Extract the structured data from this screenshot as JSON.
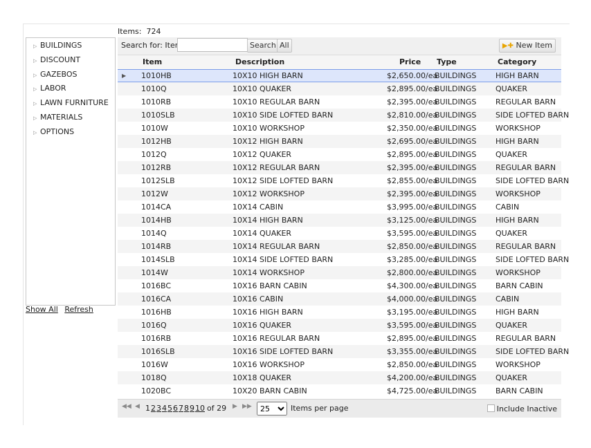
{
  "items_label": "Items:",
  "items_count": "724",
  "sidebar": {
    "categories": [
      "BUILDINGS",
      "DISCOUNT",
      "GAZEBOS",
      "LABOR",
      "LAWN FURNITURE",
      "MATERIALS",
      "OPTIONS"
    ],
    "show_all": "Show All",
    "refresh": "Refresh"
  },
  "search": {
    "label": "Search for: Item:",
    "value": "",
    "button": "Search",
    "all_button": "All",
    "new_item": "New Item"
  },
  "columns": {
    "item": "Item",
    "description": "Description",
    "price": "Price",
    "type": "Type",
    "category": "Category"
  },
  "rows": [
    [
      "1010HB",
      "10X10 HIGH BARN",
      "$2,650.00/ea",
      "BUILDINGS",
      "HIGH BARN"
    ],
    [
      "1010Q",
      "10X10 QUAKER",
      "$2,895.00/ea",
      "BUILDINGS",
      "QUAKER"
    ],
    [
      "1010RB",
      "10X10 REGULAR BARN",
      "$2,395.00/ea",
      "BUILDINGS",
      "REGULAR BARN"
    ],
    [
      "1010SLB",
      "10X10 SIDE LOFTED BARN",
      "$2,810.00/ea",
      "BUILDINGS",
      "SIDE LOFTED BARN"
    ],
    [
      "1010W",
      "10X10 WORKSHOP",
      "$2,350.00/ea",
      "BUILDINGS",
      "WORKSHOP"
    ],
    [
      "1012HB",
      "10X12 HIGH BARN",
      "$2,695.00/ea",
      "BUILDINGS",
      "HIGH BARN"
    ],
    [
      "1012Q",
      "10X12 QUAKER",
      "$2,895.00/ea",
      "BUILDINGS",
      "QUAKER"
    ],
    [
      "1012RB",
      "10X12 REGULAR BARN",
      "$2,395.00/ea",
      "BUILDINGS",
      "REGULAR BARN"
    ],
    [
      "1012SLB",
      "10X12 SIDE LOFTED BARN",
      "$2,855.00/ea",
      "BUILDINGS",
      "SIDE LOFTED BARN"
    ],
    [
      "1012W",
      "10X12 WORKSHOP",
      "$2,395.00/ea",
      "BUILDINGS",
      "WORKSHOP"
    ],
    [
      "1014CA",
      "10X14 CABIN",
      "$3,995.00/ea",
      "BUILDINGS",
      "CABIN"
    ],
    [
      "1014HB",
      "10X14 HIGH BARN",
      "$3,125.00/ea",
      "BUILDINGS",
      "HIGH BARN"
    ],
    [
      "1014Q",
      "10X14 QUAKER",
      "$3,595.00/ea",
      "BUILDINGS",
      "QUAKER"
    ],
    [
      "1014RB",
      "10X14 REGULAR BARN",
      "$2,850.00/ea",
      "BUILDINGS",
      "REGULAR BARN"
    ],
    [
      "1014SLB",
      "10X14 SIDE LOFTED BARN",
      "$3,285.00/ea",
      "BUILDINGS",
      "SIDE LOFTED BARN"
    ],
    [
      "1014W",
      "10X14 WORKSHOP",
      "$2,800.00/ea",
      "BUILDINGS",
      "WORKSHOP"
    ],
    [
      "1016BC",
      "10X16 BARN CABIN",
      "$4,300.00/ea",
      "BUILDINGS",
      "BARN CABIN"
    ],
    [
      "1016CA",
      "10X16 CABIN",
      "$4,000.00/ea",
      "BUILDINGS",
      "CABIN"
    ],
    [
      "1016HB",
      "10X16 HIGH BARN",
      "$3,195.00/ea",
      "BUILDINGS",
      "HIGH BARN"
    ],
    [
      "1016Q",
      "10X16 QUAKER",
      "$3,595.00/ea",
      "BUILDINGS",
      "QUAKER"
    ],
    [
      "1016RB",
      "10X16 REGULAR BARN",
      "$2,895.00/ea",
      "BUILDINGS",
      "REGULAR BARN"
    ],
    [
      "1016SLB",
      "10X16 SIDE LOFTED BARN",
      "$3,355.00/ea",
      "BUILDINGS",
      "SIDE LOFTED BARN"
    ],
    [
      "1016W",
      "10X16 WORKSHOP",
      "$2,850.00/ea",
      "BUILDINGS",
      "WORKSHOP"
    ],
    [
      "1018Q",
      "10X18 QUAKER",
      "$4,200.00/ea",
      "BUILDINGS",
      "QUAKER"
    ],
    [
      "1020BC",
      "10X20 BARN CABIN",
      "$4,725.00/ea",
      "BUILDINGS",
      "BARN CABIN"
    ]
  ],
  "pager": {
    "pages": [
      "1",
      "2",
      "3",
      "4",
      "5",
      "6",
      "7",
      "8",
      "9",
      "10"
    ],
    "of_text": "of 29",
    "per_page": "25",
    "per_page_label": "Items per page",
    "include_inactive": "Include Inactive"
  }
}
